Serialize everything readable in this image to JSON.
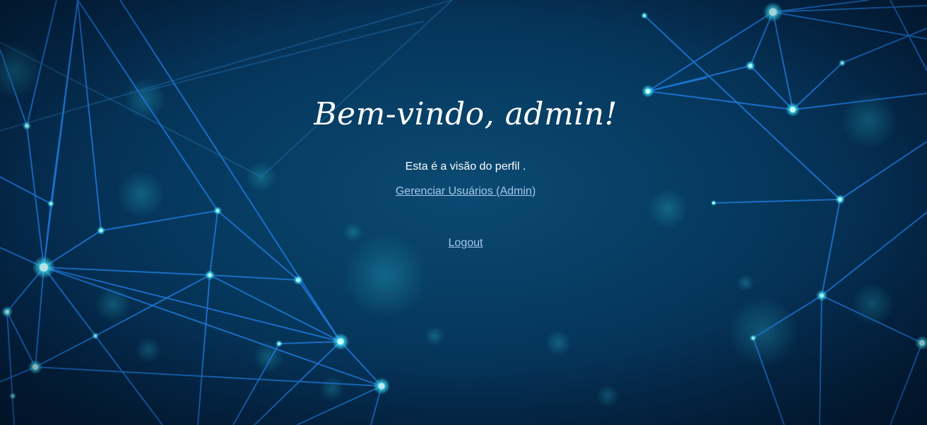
{
  "page": {
    "title": "Bem-vindo, admin!",
    "subtitle": "Esta é a visão do perfil .",
    "admin_link_label": "Gerenciar Usuários (Admin)",
    "logout_label": "Logout"
  },
  "colors": {
    "background": "#063a60",
    "text": "#ffffff",
    "link": "#a8c8ef",
    "network_line": "#1e78d8",
    "network_node": "#3ee8ff"
  }
}
